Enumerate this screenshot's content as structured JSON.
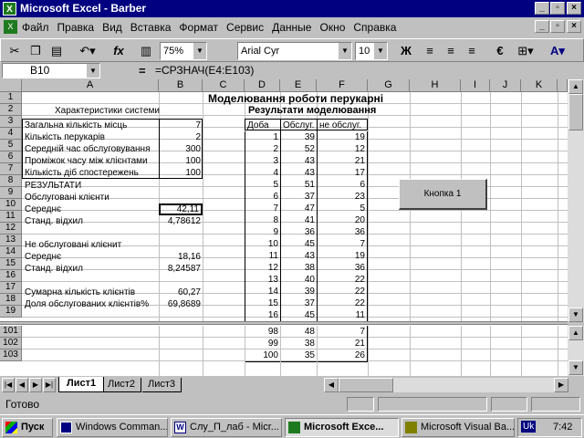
{
  "window": {
    "title": "Microsoft Excel - Barber",
    "app_icon": "excel-icon"
  },
  "menu": {
    "items": [
      "Файл",
      "Правка",
      "Вид",
      "Вставка",
      "Формат",
      "Сервис",
      "Данные",
      "Окно",
      "Справка"
    ]
  },
  "toolbar": {
    "zoom": "75%",
    "font_name": "Arial Cyr",
    "font_size": "10",
    "bold_label": "Ж",
    "fx_label": "fx"
  },
  "formula_bar": {
    "name_box": "B10",
    "eq": "=",
    "formula": "=СРЗНАЧ(E4:E103)"
  },
  "columns": [
    "A",
    "B",
    "C",
    "D",
    "E",
    "F",
    "G",
    "H",
    "I",
    "J",
    "K"
  ],
  "rows": [
    "1",
    "2",
    "3",
    "4",
    "5",
    "6",
    "7",
    "8",
    "9",
    "10",
    "11",
    "12",
    "13",
    "14",
    "15",
    "16",
    "17",
    "18",
    "19"
  ],
  "bottom_rows": [
    "101",
    "102",
    "103"
  ],
  "sheet": {
    "title": "Моделювання роботи перукарні",
    "left_header": "Характеристики системи",
    "right_header": "Результати моделювання",
    "params": [
      {
        "label": "Загальна кількість місць",
        "value": "7"
      },
      {
        "label": "Кількість перукарів",
        "value": "2"
      },
      {
        "label": "Середній час обслуговування",
        "value": "300"
      },
      {
        "label": "Проміжок часу між клієнтами",
        "value": "100"
      },
      {
        "label": "Кількість діб спостережень",
        "value": "100"
      }
    ],
    "results_label": "РЕЗУЛЬТАТИ",
    "served_label": "Обслуговані клієнти",
    "served_mean_label": "Середнє",
    "served_mean": "42,11",
    "served_std_label": "Станд. відхил",
    "served_std": "4,78612",
    "not_served_label": "Не обслуговані клієнит",
    "ns_mean_label": "Середнє",
    "ns_mean": "18,16",
    "ns_std_label": "Станд. відхил",
    "ns_std": "8,24587",
    "total_label": "Сумарна кількість клієнтів",
    "total": "60,27",
    "share_label": "Доля обслугованих клієнтів%",
    "share": "69,8689",
    "table_headers": [
      "Доба",
      "Обслуг.",
      "не обслуг."
    ],
    "table_rows": [
      [
        "1",
        "39",
        "19"
      ],
      [
        "2",
        "52",
        "12"
      ],
      [
        "3",
        "43",
        "21"
      ],
      [
        "4",
        "43",
        "17"
      ],
      [
        "5",
        "51",
        "6"
      ],
      [
        "6",
        "37",
        "23"
      ],
      [
        "7",
        "47",
        "5"
      ],
      [
        "8",
        "41",
        "20"
      ],
      [
        "9",
        "36",
        "36"
      ],
      [
        "10",
        "45",
        "7"
      ],
      [
        "11",
        "43",
        "19"
      ],
      [
        "12",
        "38",
        "36"
      ],
      [
        "13",
        "40",
        "22"
      ],
      [
        "14",
        "39",
        "22"
      ],
      [
        "15",
        "37",
        "22"
      ],
      [
        "16",
        "45",
        "11"
      ]
    ],
    "bottom_table_rows": [
      [
        "98",
        "48",
        "7"
      ],
      [
        "99",
        "38",
        "21"
      ],
      [
        "100",
        "35",
        "26"
      ]
    ],
    "button_label": "Кнопка 1"
  },
  "tabs": [
    "Лист1",
    "Лист2",
    "Лист3"
  ],
  "status": "Готово",
  "taskbar": {
    "start": "Пуск",
    "tasks": [
      "Windows Comman...",
      "Слу_П_лаб - Micr...",
      "Microsoft Exce...",
      "Microsoft Visual Ba..."
    ],
    "lang": "Uk",
    "clock": "7:42"
  }
}
